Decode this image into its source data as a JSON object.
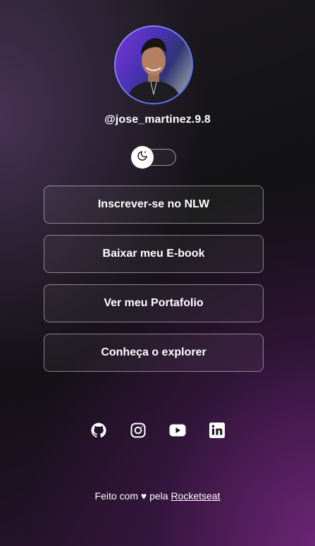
{
  "profile": {
    "handle": "@jose_martinez.9.8",
    "avatar_alt": "avatar"
  },
  "theme_toggle": {
    "icon": "moon-icon",
    "state": "dark"
  },
  "links": [
    {
      "label": "Inscrever-se no NLW"
    },
    {
      "label": "Baixar meu E-book"
    },
    {
      "label": "Ver meu Portafolio"
    },
    {
      "label": "Conheça o explorer"
    }
  ],
  "social": [
    {
      "icon": "github-icon"
    },
    {
      "icon": "instagram-icon"
    },
    {
      "icon": "youtube-icon"
    },
    {
      "icon": "linkedin-icon"
    }
  ],
  "footer": {
    "prefix": "Feito com ♥ pela",
    "link_label": "Rocketseat"
  }
}
